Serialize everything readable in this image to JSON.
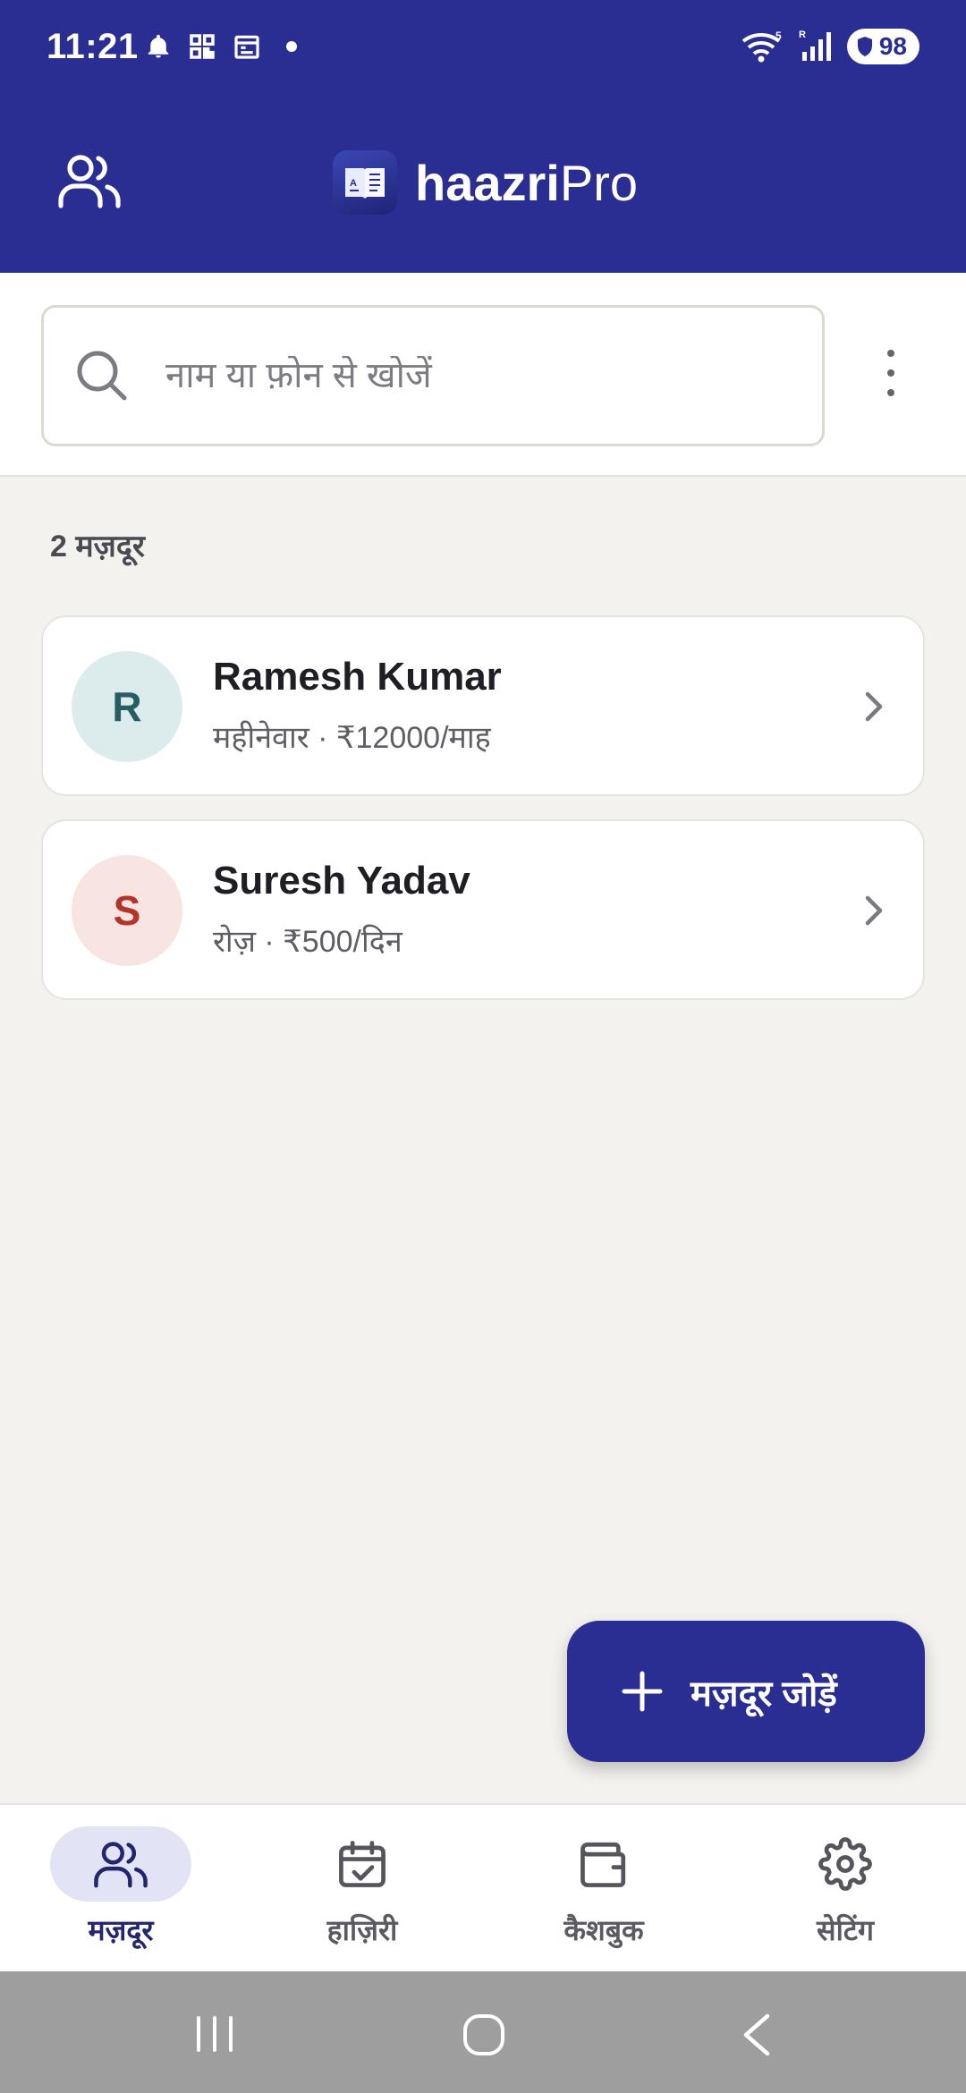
{
  "status_bar": {
    "time": "11:21",
    "network_label": "5",
    "roaming_label": "R",
    "battery": "98"
  },
  "header": {
    "brand_bold": "haazri",
    "brand_light": "Pro"
  },
  "search": {
    "placeholder": "नाम या फ़ोन से खोजें",
    "value": ""
  },
  "list": {
    "count_label": "2 मज़दूर",
    "workers": [
      {
        "initial": "R",
        "name": "Ramesh Kumar",
        "subtitle": "महीनेवार · ₹12000/माह",
        "avatar_bg": "#DCEBEC",
        "avatar_fg": "#285E63"
      },
      {
        "initial": "S",
        "name": "Suresh Yadav",
        "subtitle": "रोज़ · ₹500/दिन",
        "avatar_bg": "#F8E4E1",
        "avatar_fg": "#B3342B"
      }
    ]
  },
  "fab": {
    "label": "मज़दूर जोड़ें"
  },
  "bottom_nav": {
    "items": [
      {
        "label": "मज़दूर",
        "icon": "users-icon",
        "active": true
      },
      {
        "label": "हाज़िरी",
        "icon": "calendar-check-icon",
        "active": false
      },
      {
        "label": "कैशबुक",
        "icon": "wallet-icon",
        "active": false
      },
      {
        "label": "सेटिंग",
        "icon": "gear-icon",
        "active": false
      }
    ]
  },
  "colors": {
    "primary": "#2A2D91",
    "background": "#F3F2EE",
    "card": "#FFFFFF"
  }
}
